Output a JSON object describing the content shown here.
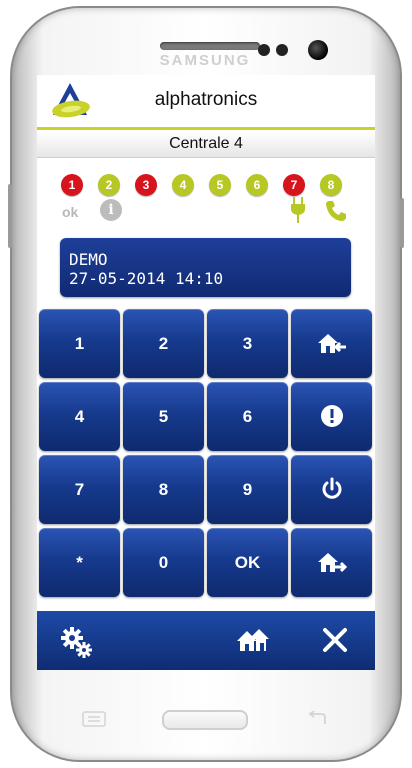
{
  "device": {
    "brand": "SAMSUNG"
  },
  "app": {
    "title": "alphatronics"
  },
  "subbar": {
    "title": "Centrale 4"
  },
  "zones": [
    {
      "label": "1",
      "color": "#d7141c"
    },
    {
      "label": "2",
      "color": "#b7c824"
    },
    {
      "label": "3",
      "color": "#d7141c"
    },
    {
      "label": "4",
      "color": "#b7c824"
    },
    {
      "label": "5",
      "color": "#b7c824"
    },
    {
      "label": "6",
      "color": "#b7c824"
    },
    {
      "label": "7",
      "color": "#d7141c"
    },
    {
      "label": "8",
      "color": "#b7c824"
    }
  ],
  "status": {
    "ok_label": "ok",
    "info_icon": "info-icon",
    "plug_icon": "plug-icon",
    "phone_icon": "phone-icon"
  },
  "display": {
    "line1": "DEMO",
    "line2": "27-05-2014 14:10"
  },
  "keypad": [
    {
      "label": "1"
    },
    {
      "label": "2"
    },
    {
      "label": "3"
    },
    {
      "label": "",
      "icon": "home-arrow-in-icon"
    },
    {
      "label": "4"
    },
    {
      "label": "5"
    },
    {
      "label": "6"
    },
    {
      "label": "",
      "icon": "alert-icon"
    },
    {
      "label": "7"
    },
    {
      "label": "8"
    },
    {
      "label": "9"
    },
    {
      "label": "",
      "icon": "power-icon"
    },
    {
      "label": "*"
    },
    {
      "label": "0"
    },
    {
      "label": "OK"
    },
    {
      "label": "",
      "icon": "home-arrow-out-icon"
    }
  ],
  "bottom_bar": [
    {
      "icon": "settings-gears-icon"
    },
    {
      "icon": "houses-icon"
    },
    {
      "icon": "close-icon"
    }
  ],
  "colors": {
    "accent": "#c9d22a",
    "key_blue": "#163a8e",
    "zone_red": "#d7141c",
    "zone_green": "#b7c824"
  }
}
